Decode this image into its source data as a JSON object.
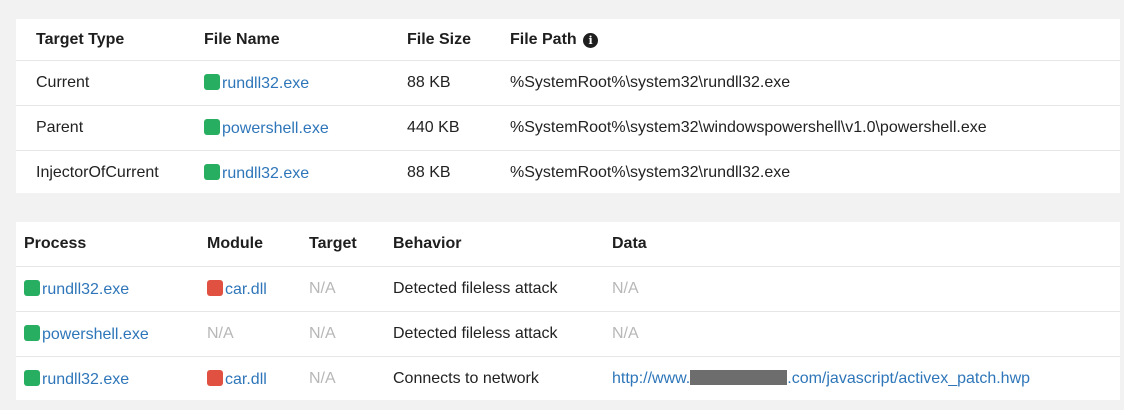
{
  "colors": {
    "green": "#27ae60",
    "red": "#e05142",
    "link": "#2e76b9",
    "muted": "#b7b7b7"
  },
  "targets": {
    "headers": {
      "target_type": "Target Type",
      "file_name": "File Name",
      "file_size": "File Size",
      "file_path": "File Path",
      "file_path_icon": "info-circle-icon"
    },
    "rows": [
      {
        "target_type": "Current",
        "file_name": "rundll32.exe",
        "file_size": "88 KB",
        "file_path": "%SystemRoot%\\system32\\rundll32.exe"
      },
      {
        "target_type": "Parent",
        "file_name": "powershell.exe",
        "file_size": "440 KB",
        "file_path": "%SystemRoot%\\system32\\windowspowershell\\v1.0\\powershell.exe"
      },
      {
        "target_type": "InjectorOfCurrent",
        "file_name": "rundll32.exe",
        "file_size": "88 KB",
        "file_path": "%SystemRoot%\\system32\\rundll32.exe"
      }
    ]
  },
  "events": {
    "headers": {
      "process": "Process",
      "module": "Module",
      "target": "Target",
      "behavior": "Behavior",
      "data": "Data"
    },
    "rows": [
      {
        "process": "rundll32.exe",
        "module": "car.dll",
        "target": "N/A",
        "behavior": "Detected fileless attack",
        "data": "N/A"
      },
      {
        "process": "powershell.exe",
        "module": "N/A",
        "target": "N/A",
        "behavior": "Detected fileless attack",
        "data": "N/A"
      },
      {
        "process": "rundll32.exe",
        "module": "car.dll",
        "target": "N/A",
        "behavior": "Connects to network",
        "data_prefix": "http://www.",
        "data_suffix": ".com/javascript/activex_patch.hwp"
      }
    ]
  }
}
